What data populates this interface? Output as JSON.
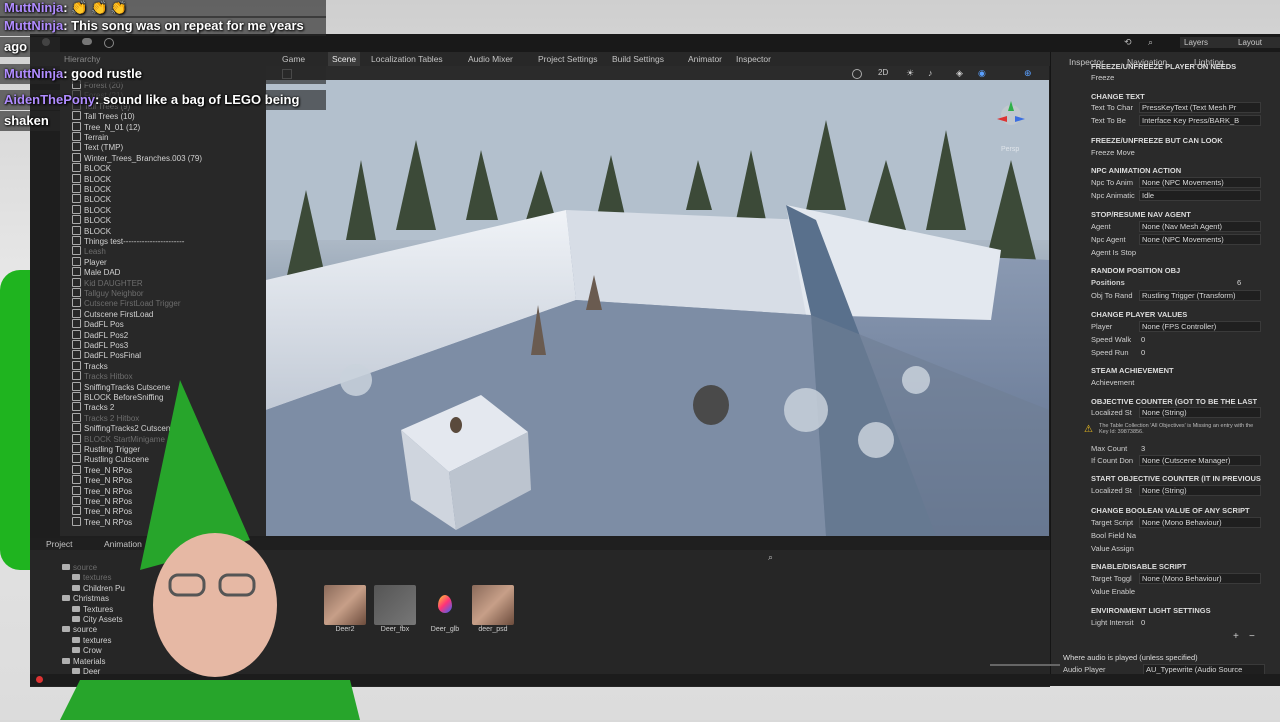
{
  "chat": [
    {
      "user": "MuttNinja",
      "message": ": 👏 👏 👏",
      "color": "#b08cff"
    },
    {
      "user": "MuttNinja",
      "message": ": This song was on repeat for me years",
      "color": "#b08cff"
    },
    {
      "user": "",
      "message": "ago",
      "color": "#ffffff"
    },
    {
      "user": "MuttNinja",
      "message": ": good rustle",
      "color": "#b08cff"
    },
    {
      "user": "AidenThePony",
      "message": ": sound like a bag of LEGO being",
      "color": "#b08cff"
    },
    {
      "user": "",
      "message": "shaken",
      "color": "#ffffff"
    }
  ],
  "tabs": {
    "hierarchy": "Hierarchy",
    "game": "Game",
    "scene": "Scene",
    "localization": "Localization Tables",
    "audio_mixer": "Audio Mixer",
    "project_settings": "Project Settings",
    "build_settings": "Build Settings",
    "animator": "Animator",
    "inspector_tab": "Inspector",
    "inspector": "Inspector",
    "navigation": "Navigation",
    "lighting": "Lighting",
    "project": "Project",
    "animation": "Animation"
  },
  "toolbar": {
    "layers": "Layers",
    "layout": "Layout"
  },
  "scene_tools": {
    "mode_2d": "2D",
    "persp": "Persp"
  },
  "hierarchy": [
    {
      "label": "Forest (20)",
      "dim": true
    },
    {
      "label": "Forest (21)",
      "dim": true
    },
    {
      "label": "Tall Trees (9)",
      "dim": false
    },
    {
      "label": "Tall Trees (10)",
      "dim": false
    },
    {
      "label": "Tree_N_01 (12)",
      "dim": false
    },
    {
      "label": "Terrain",
      "dim": false
    },
    {
      "label": "Text (TMP)",
      "dim": false
    },
    {
      "label": "Winter_Trees_Branches.003 (79)",
      "dim": false
    },
    {
      "label": "BLOCK",
      "dim": false
    },
    {
      "label": "BLOCK",
      "dim": false
    },
    {
      "label": "BLOCK",
      "dim": false
    },
    {
      "label": "BLOCK",
      "dim": false
    },
    {
      "label": "BLOCK",
      "dim": false
    },
    {
      "label": "BLOCK",
      "dim": false
    },
    {
      "label": "BLOCK",
      "dim": false
    },
    {
      "label": "Things test-----------------------",
      "dim": false
    },
    {
      "label": "Leash",
      "dim": true
    },
    {
      "label": "Player",
      "dim": false
    },
    {
      "label": "Male DAD",
      "dim": false
    },
    {
      "label": "Kid DAUGHTER",
      "dim": true
    },
    {
      "label": "Tallguy Neighbor",
      "dim": true
    },
    {
      "label": "Cutscene FirstLoad Trigger",
      "dim": true
    },
    {
      "label": "Cutscene FirstLoad",
      "dim": false
    },
    {
      "label": "DadFL Pos",
      "dim": false
    },
    {
      "label": "DadFL Pos2",
      "dim": false
    },
    {
      "label": "DadFL Pos3",
      "dim": false
    },
    {
      "label": "DadFL PosFinal",
      "dim": false
    },
    {
      "label": "Tracks",
      "dim": false
    },
    {
      "label": "Tracks Hitbox",
      "dim": true
    },
    {
      "label": "SniffingTracks Cutscene",
      "dim": false
    },
    {
      "label": "BLOCK BeforeSniffing",
      "dim": false
    },
    {
      "label": "Tracks 2",
      "dim": false
    },
    {
      "label": "Tracks 2 Hitbox",
      "dim": true
    },
    {
      "label": "SniffingTracks2 Cutscene",
      "dim": false
    },
    {
      "label": "BLOCK StartMinigame",
      "dim": true
    },
    {
      "label": "Rustling Trigger",
      "dim": false
    },
    {
      "label": "Rustling Cutscene",
      "dim": false
    },
    {
      "label": "Tree_N RPos",
      "dim": false
    },
    {
      "label": "Tree_N RPos",
      "dim": false
    },
    {
      "label": "Tree_N RPos",
      "dim": false
    },
    {
      "label": "Tree_N RPos",
      "dim": false
    },
    {
      "label": "Tree_N RPos",
      "dim": false
    },
    {
      "label": "Tree_N RPos",
      "dim": false
    }
  ],
  "inspector": {
    "freeze_top": "FREEZE/UNFREEZE PLAYER ON NEEDS",
    "freeze_label": "Freeze",
    "change_text": "CHANGE TEXT",
    "text_to_change": "Text To Char",
    "text_to_change_val": "PressKeyText (Text Mesh Pr",
    "text_to_be": "Text To Be",
    "text_to_be_val": "Interface Key Press/BARK_B",
    "freeze_look": "FREEZE/UNFREEZE BUT CAN LOOK",
    "freeze_move": "Freeze Move",
    "npc_anim": "NPC ANIMATION ACTION",
    "npc_to_anim": "Npc To Anim",
    "npc_to_anim_val": "None (NPC Movements)",
    "npc_animation": "Npc Animatic",
    "npc_animation_val": "Idle",
    "stop_nav": "STOP/RESUME NAV AGENT",
    "agent": "Agent",
    "agent_val": "None (Nav Mesh Agent)",
    "npc_agent": "Npc Agent",
    "npc_agent_val": "None (NPC Movements)",
    "agent_stop": "Agent Is Stop",
    "random_pos": "RANDOM POSITION OBJ",
    "positions": "Positions",
    "positions_val": "6",
    "obj_to_rand": "Obj To Rand",
    "obj_to_rand_val": "Rustling Trigger (Transform)",
    "change_player": "CHANGE PLAYER VALUES",
    "player": "Player",
    "player_val": "None (FPS Controller)",
    "speed_walk": "Speed Walk",
    "speed_walk_val": "0",
    "speed_run": "Speed Run",
    "speed_run_val": "0",
    "steam": "STEAM ACHIEVEMENT",
    "achievement": "Achievement",
    "objective": "OBJECTIVE COUNTER (GOT TO BE THE LAST",
    "localized": "Localized St",
    "localized_val": "None (String)",
    "warning": "The Table Collection 'All Objectives' is Missing an entry with the Key Id: 39873856.",
    "max_count": "Max Count",
    "max_count_val": "3",
    "if_count": "If Count Don",
    "if_count_val": "None (Cutscene Manager)",
    "start_objective": "START OBJECTIVE COUNTER (IT IN PREVIOUS",
    "localized2": "Localized St",
    "localized2_val": "None (String)",
    "change_bool": "CHANGE BOOLEAN VALUE OF ANY SCRIPT",
    "target_script": "Target Script",
    "target_script_val": "None (Mono Behaviour)",
    "bool_field": "Bool Field Na",
    "value_assign": "Value Assign",
    "enable_script": "ENABLE/DISABLE SCRIPT",
    "target_toggle": "Target Toggl",
    "target_toggle_val": "None (Mono Behaviour)",
    "value_enable": "Value Enable",
    "env_light": "ENVIRONMENT LIGHT SETTINGS",
    "light_intensity": "Light Intensit",
    "light_intensity_val": "0",
    "audio_where": "Where audio is played (unless specified)",
    "audio_player": "Audio Player",
    "audio_player_val": "AU_Typewrite (Audio Source"
  },
  "project_tree": [
    {
      "label": "source",
      "dim": true
    },
    {
      "label": "textures",
      "dim": true
    },
    {
      "label": "Children Pu",
      "dim": false
    },
    {
      "label": "Christmas",
      "dim": false
    },
    {
      "label": "Textures",
      "dim": false
    },
    {
      "label": "City Assets",
      "dim": false
    },
    {
      "label": "source",
      "dim": false
    },
    {
      "label": "textures",
      "dim": false
    },
    {
      "label": "Crow",
      "dim": false
    },
    {
      "label": "Materials",
      "dim": false
    },
    {
      "label": "Deer",
      "dim": false
    }
  ],
  "assets": [
    {
      "label": "Deer2"
    },
    {
      "label": "Deer_fbx"
    },
    {
      "label": "Deer_glb"
    },
    {
      "label": "deer_psd"
    }
  ]
}
